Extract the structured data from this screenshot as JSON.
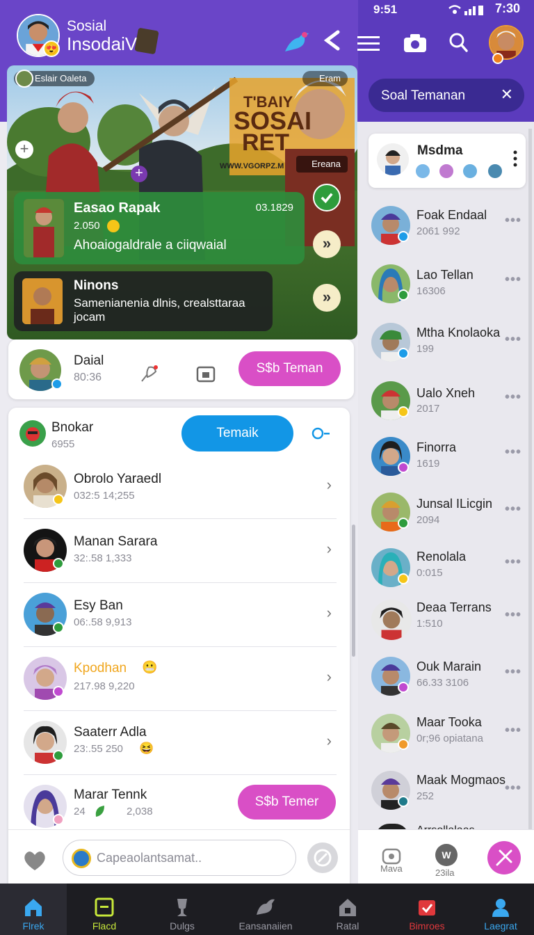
{
  "status": {
    "left": "9:51",
    "time": "7:30"
  },
  "header": {
    "line1": "Sosial",
    "line2": "InsodaiV"
  },
  "search_chip": {
    "label": "Soal Temanan",
    "close": "✕"
  },
  "banner": {
    "tag": "Eslair Oaleta",
    "top_right": "Eram",
    "art_title": [
      "T'BAIY",
      "SOSAI",
      "RET"
    ],
    "url": "WWW.VGORPZ.M",
    "bottom_right": "Ereana"
  },
  "post1": {
    "title": "Easao Rapak",
    "time": "03.1829",
    "count": "2.050",
    "desc": "Ahoaiogaldrale a ciiqwaial"
  },
  "post2": {
    "title": "Ninons",
    "desc": "Samenianenia dlnis, crealsttaraa jocam"
  },
  "daial": {
    "name": "Daial",
    "meta": "80:36",
    "button": "S$b Teman"
  },
  "list_header": {
    "name": "Bnokar",
    "meta": "6955",
    "button": "Temaik"
  },
  "contacts": [
    {
      "name": "Obrolo Yaraedl",
      "meta": "032:5 14;255"
    },
    {
      "name": "Manan Sarara",
      "meta": "32:.58   1,333"
    },
    {
      "name": "Esy Ban",
      "meta": "06:.58   9,913"
    },
    {
      "name": "Kpodhan",
      "meta": "217.98   9,220"
    },
    {
      "name": "Saaterr Adla",
      "meta": "23:.55   250"
    },
    {
      "name": "Marar Tennk",
      "meta": "24",
      "meta2": "2,038",
      "button": "S$b Temer"
    }
  ],
  "composer": {
    "placeholder": "Capeaolantsamat.."
  },
  "right_card": {
    "title": "Msdma"
  },
  "right_list": [
    {
      "name": "Foak Endaal",
      "meta": "2061 992"
    },
    {
      "name": "Lao Tellan",
      "meta": "16306"
    },
    {
      "name": "Mtha Knolaoka",
      "meta": "199"
    },
    {
      "name": "Ualo Xneh",
      "meta": "2017"
    },
    {
      "name": "Finorra",
      "meta": "1619"
    },
    {
      "name": "Junsal ILicgin",
      "meta": "2094"
    },
    {
      "name": "Renolala",
      "meta": "0:015"
    },
    {
      "name": "Deaa Terrans",
      "meta": "1:510"
    },
    {
      "name": "Ouk Marain",
      "meta": "66.33 3106"
    },
    {
      "name": "Maar Tooka",
      "meta": "0r;96 opiatana"
    },
    {
      "name": "Maak Mogmaos",
      "meta": "252"
    },
    {
      "name": "Arrsollalaas",
      "meta": ""
    }
  ],
  "right_bottom": {
    "a": "Mava",
    "b": "23ila"
  },
  "nav": [
    {
      "label": "Flrek"
    },
    {
      "label": "Flacd"
    },
    {
      "label": "Dulgs"
    },
    {
      "label": "Eansanaiien"
    },
    {
      "label": "Ratal"
    },
    {
      "label": "Bimroes"
    },
    {
      "label": "Laegrat"
    }
  ],
  "colors": {
    "purple": "#5b3bbd",
    "pink": "#d94fc6",
    "blue": "#1296e6",
    "green": "#2e9c3c"
  }
}
